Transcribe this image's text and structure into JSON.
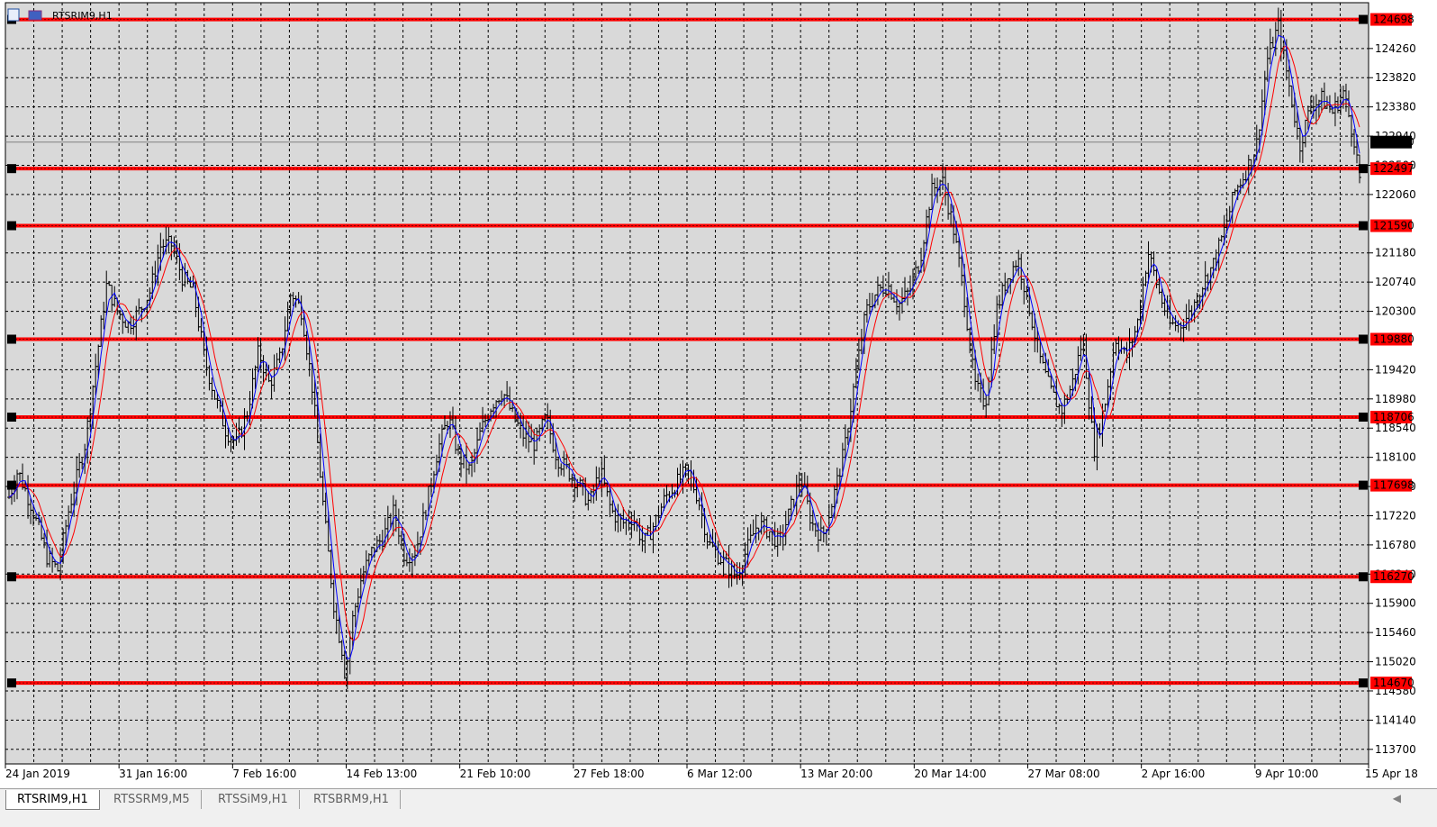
{
  "window": {
    "title": "RTSRIM9,H1"
  },
  "tabs": [
    {
      "label": "RTSRIM9,H1",
      "active": true
    },
    {
      "label": "RTSSRM9,M5",
      "active": false
    },
    {
      "label": "RTSSiM9,H1",
      "active": false
    },
    {
      "label": "RTSBRM9,H1",
      "active": false
    }
  ],
  "colors": {
    "background": "#d9d9d9",
    "grid": "#000000",
    "bars": "#000000",
    "ma_fast": "#0000ff",
    "ma_slow": "#ff0000",
    "levels": "#ff0000",
    "level_label_bg": "#ff0000"
  },
  "icons": [
    "chart-window-icon",
    "chart-type-icon"
  ],
  "chart_data": {
    "type": "ohlc",
    "symbol": "RTSRIM9",
    "timeframe": "H1",
    "ylim": [
      113480,
      124950
    ],
    "grid": true,
    "current_price": "122850",
    "price_ticks": [
      "124260",
      "123820",
      "123380",
      "122940",
      "122500",
      "122060",
      "121180",
      "120740",
      "120300",
      "119420",
      "118980",
      "118540",
      "118100",
      "117660",
      "117220",
      "116780",
      "116340",
      "115900",
      "115460",
      "115020",
      "114580",
      "114140",
      "113700"
    ],
    "time_ticks": [
      "24 Jan 2019",
      "31 Jan 16:00",
      "7 Feb 16:00",
      "14 Feb 13:00",
      "21 Feb 10:00",
      "27 Feb 18:00",
      "6 Mar 12:00",
      "13 Mar 20:00",
      "20 Mar 14:00",
      "27 Mar 08:00",
      "2 Apr 16:00",
      "9 Apr 10:00",
      "15 Apr 18"
    ],
    "levels": [
      {
        "label": "124698",
        "value": 124698
      },
      {
        "label": "122497",
        "value": 122450
      },
      {
        "label": "121590",
        "value": 121590
      },
      {
        "label": "119880",
        "value": 119880
      },
      {
        "label": "118706",
        "value": 118706
      },
      {
        "label": "117698",
        "value": 117680
      },
      {
        "label": "116270",
        "value": 116300
      },
      {
        "label": "114670",
        "value": 114700
      }
    ],
    "price_path": [
      [
        0,
        117500
      ],
      [
        0.8,
        117900
      ],
      [
        2,
        117400
      ],
      [
        3.5,
        116600
      ],
      [
        4.5,
        116400
      ],
      [
        5.5,
        117300
      ],
      [
        7,
        118300
      ],
      [
        8,
        119500
      ],
      [
        9,
        120700
      ],
      [
        10,
        120300
      ],
      [
        11,
        120100
      ],
      [
        12,
        120300
      ],
      [
        13,
        120600
      ],
      [
        14,
        121300
      ],
      [
        15,
        121300
      ],
      [
        16,
        120800
      ],
      [
        17,
        120600
      ],
      [
        18,
        119600
      ],
      [
        19,
        119000
      ],
      [
        20,
        118500
      ],
      [
        21,
        118300
      ],
      [
        22,
        118800
      ],
      [
        23,
        119700
      ],
      [
        24,
        119200
      ],
      [
        25,
        119600
      ],
      [
        26,
        120600
      ],
      [
        27,
        120300
      ],
      [
        28,
        119100
      ],
      [
        29,
        117300
      ],
      [
        30,
        115800
      ],
      [
        30.7,
        115200
      ],
      [
        31,
        114800
      ],
      [
        31.6,
        115600
      ],
      [
        32.5,
        116300
      ],
      [
        33.5,
        116700
      ],
      [
        34.5,
        116900
      ],
      [
        35.5,
        117300
      ],
      [
        36.5,
        116600
      ],
      [
        37.5,
        116700
      ],
      [
        38.5,
        117400
      ],
      [
        39.5,
        118200
      ],
      [
        40.5,
        118700
      ],
      [
        41.5,
        118100
      ],
      [
        42.5,
        117900
      ],
      [
        43.5,
        118500
      ],
      [
        44.5,
        118900
      ],
      [
        45.5,
        119100
      ],
      [
        46.5,
        118700
      ],
      [
        47.5,
        118400
      ],
      [
        48.5,
        118300
      ],
      [
        49.5,
        118700
      ],
      [
        50.5,
        118100
      ],
      [
        51.5,
        117900
      ],
      [
        52.5,
        117700
      ],
      [
        53.5,
        117400
      ],
      [
        54.5,
        117900
      ],
      [
        55.5,
        117300
      ],
      [
        56.5,
        117100
      ],
      [
        57.5,
        117200
      ],
      [
        58.5,
        116800
      ],
      [
        59.5,
        117100
      ],
      [
        60.5,
        117500
      ],
      [
        61.5,
        117700
      ],
      [
        62.5,
        117900
      ],
      [
        63.5,
        117500
      ],
      [
        64.5,
        116800
      ],
      [
        65.5,
        116600
      ],
      [
        66.5,
        116400
      ],
      [
        67,
        116300
      ],
      [
        68,
        116700
      ],
      [
        69,
        117100
      ],
      [
        70,
        117000
      ],
      [
        71,
        116800
      ],
      [
        72,
        117300
      ],
      [
        73,
        117800
      ],
      [
        74,
        117100
      ],
      [
        75,
        116900
      ],
      [
        76,
        117500
      ],
      [
        77,
        118200
      ],
      [
        78,
        119300
      ],
      [
        79,
        120300
      ],
      [
        80,
        120600
      ],
      [
        81,
        120700
      ],
      [
        82,
        120400
      ],
      [
        83,
        120600
      ],
      [
        84,
        121100
      ],
      [
        85,
        122100
      ],
      [
        86,
        122300
      ],
      [
        87,
        121600
      ],
      [
        88,
        120600
      ],
      [
        89,
        119200
      ],
      [
        90,
        118900
      ],
      [
        91,
        120300
      ],
      [
        92,
        120800
      ],
      [
        93,
        121100
      ],
      [
        94,
        120400
      ],
      [
        95,
        119600
      ],
      [
        96,
        119100
      ],
      [
        97,
        118800
      ],
      [
        98,
        119200
      ],
      [
        99,
        119900
      ],
      [
        100,
        118200
      ],
      [
        101,
        118900
      ],
      [
        102,
        119900
      ],
      [
        103,
        119600
      ],
      [
        104,
        120100
      ],
      [
        105,
        121200
      ],
      [
        106,
        120600
      ],
      [
        107,
        120100
      ],
      [
        108,
        120100
      ],
      [
        109,
        120300
      ],
      [
        110,
        120700
      ],
      [
        111,
        121000
      ],
      [
        112,
        121500
      ],
      [
        113,
        122100
      ],
      [
        114,
        122400
      ],
      [
        115,
        122800
      ],
      [
        116,
        124100
      ],
      [
        117,
        124600
      ],
      [
        118,
        123700
      ],
      [
        119,
        122800
      ],
      [
        120,
        123400
      ],
      [
        121,
        123500
      ],
      [
        122,
        123300
      ],
      [
        123,
        123600
      ],
      [
        124,
        122900
      ],
      [
        124.5,
        122300
      ]
    ]
  }
}
